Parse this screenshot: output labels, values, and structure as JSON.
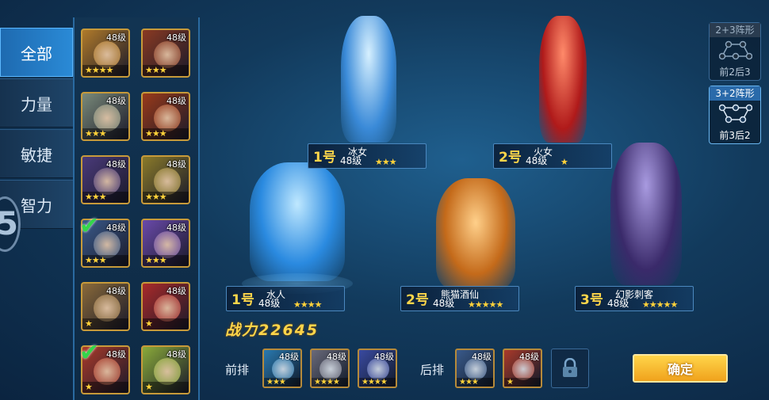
{
  "tabs": [
    {
      "label": "全部",
      "active": true
    },
    {
      "label": "力量",
      "active": false
    },
    {
      "label": "敏捷",
      "active": false
    },
    {
      "label": "智力",
      "active": false
    }
  ],
  "side_badge": "5",
  "hero_grid": [
    {
      "level": "48级",
      "stars": "★★★★",
      "color": "#b07a2a",
      "checked": false
    },
    {
      "level": "48级",
      "stars": "★★★",
      "color": "#8a3a22",
      "checked": false
    },
    {
      "level": "48级",
      "stars": "★★★",
      "color": "#7a8a7a",
      "checked": false
    },
    {
      "level": "48级",
      "stars": "★★★",
      "color": "#9a3a1a",
      "checked": false
    },
    {
      "level": "48级",
      "stars": "★★★",
      "color": "#4a3a7a",
      "checked": false
    },
    {
      "level": "48级",
      "stars": "★★★",
      "color": "#8a7a2a",
      "checked": false
    },
    {
      "level": "48级",
      "stars": "★★★",
      "color": "#3a5a8a",
      "checked": true
    },
    {
      "level": "48级",
      "stars": "★★★",
      "color": "#6a4aaa",
      "checked": false
    },
    {
      "level": "48级",
      "stars": "★",
      "color": "#8a6a3a",
      "checked": false
    },
    {
      "level": "48级",
      "stars": "★",
      "color": "#aa2a2a",
      "checked": false
    },
    {
      "level": "48级",
      "stars": "★",
      "color": "#aa3a2a",
      "checked": true
    },
    {
      "level": "48级",
      "stars": "★",
      "color": "#8aaa3a",
      "checked": false
    }
  ],
  "lineup": [
    {
      "slot": "1号",
      "name": "冰女",
      "level": "48级",
      "stars": "★★★",
      "color": "#6ab6f0"
    },
    {
      "slot": "2号",
      "name": "火女",
      "level": "48级",
      "stars": "★",
      "color": "#c42a2a"
    },
    {
      "slot": "1号",
      "name": "水人",
      "level": "48级",
      "stars": "★★★★",
      "color": "#3a9ae8"
    },
    {
      "slot": "2号",
      "name": "熊猫酒仙",
      "level": "48级",
      "stars": "★★★★★",
      "color": "#d88a2a"
    },
    {
      "slot": "3号",
      "name": "幻影刺客",
      "level": "48级",
      "stars": "★★★★★",
      "color": "#5a4a8a"
    }
  ],
  "combat_power": "战力22645",
  "front_label": "前排",
  "back_label": "后排",
  "front_slots": [
    {
      "level": "48级",
      "stars": "★★★",
      "color": "#2a7ab0"
    },
    {
      "level": "48级",
      "stars": "★★★★",
      "color": "#6a6a7a"
    },
    {
      "level": "48级",
      "stars": "★★★★",
      "color": "#3a4aa0"
    }
  ],
  "back_slots": [
    {
      "level": "48级",
      "stars": "★★★",
      "color": "#3a5a8a"
    },
    {
      "level": "48级",
      "stars": "★",
      "color": "#aa3a2a"
    }
  ],
  "confirm_label": "确定",
  "formations": [
    {
      "title": "2+3阵形",
      "sub": "前2后3",
      "active": false
    },
    {
      "title": "3+2阵形",
      "sub": "前3后2",
      "active": true
    }
  ]
}
